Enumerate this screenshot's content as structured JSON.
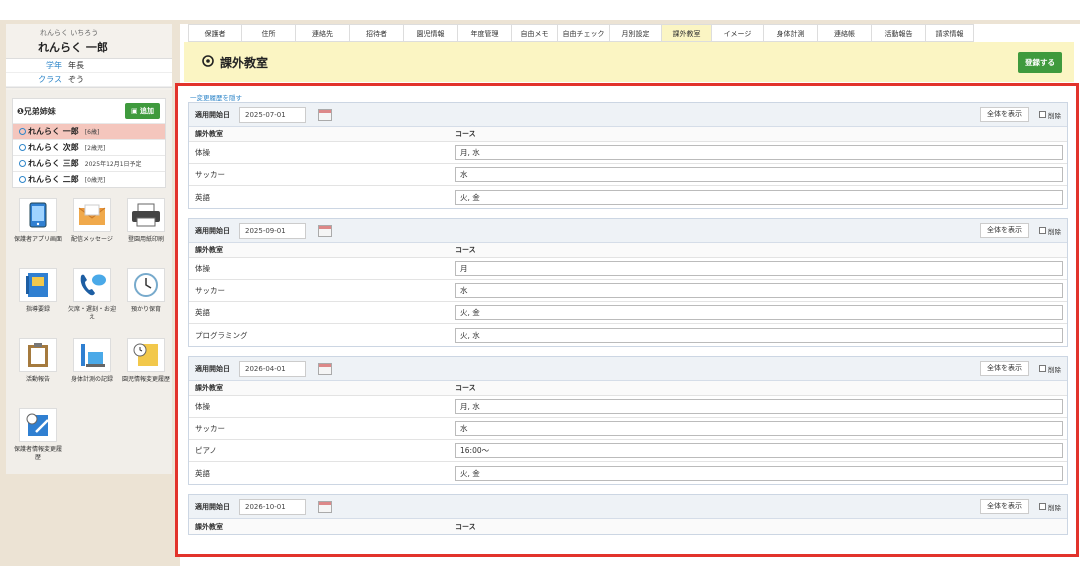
{
  "student": {
    "kana": "れんらく いちろう",
    "name": "れんらく 一郎",
    "grade_label": "学年",
    "grade_value": "年長",
    "class_label": "クラス",
    "class_value": "ぞう"
  },
  "siblings": {
    "title": "兄弟姉妹",
    "add_label": "追加",
    "items": [
      {
        "name": "れんらく 一郎",
        "age": "[6歳]"
      },
      {
        "name": "れんらく 次郎",
        "age": "[2歳児]"
      },
      {
        "name": "れんらく 三郎",
        "age": "2025年12月1日予定"
      },
      {
        "name": "れんらく 二郎",
        "age": "[0歳児]"
      }
    ]
  },
  "menu": [
    {
      "label": "保護者アプリ画面",
      "icon": "smartphone-icon"
    },
    {
      "label": "配信メッセージ",
      "icon": "envelope-icon"
    },
    {
      "label": "登園用紙印刷",
      "icon": "printer-icon"
    },
    {
      "label": "指導要録",
      "icon": "notebook-icon"
    },
    {
      "label": "欠席・遅刻・お迎え",
      "icon": "phone-chat-icon"
    },
    {
      "label": "預かり保育",
      "icon": "clock-icon"
    },
    {
      "label": "活動報告",
      "icon": "clipboard-icon"
    },
    {
      "label": "身体計測の記録",
      "icon": "scale-icon"
    },
    {
      "label": "園児情報変更履歴",
      "icon": "note-clock-icon"
    },
    {
      "label": "保護者情報変更履歴",
      "icon": "edit-note-icon"
    }
  ],
  "tabs": [
    {
      "label": "保護者",
      "active": false
    },
    {
      "label": "住所",
      "active": false
    },
    {
      "label": "連絡先",
      "active": false
    },
    {
      "label": "招待者",
      "active": false
    },
    {
      "label": "園児情報",
      "active": false
    },
    {
      "label": "年度管理",
      "active": false
    },
    {
      "label": "自由メモ",
      "active": false
    },
    {
      "label": "自由チェック",
      "active": false
    },
    {
      "label": "月別設定",
      "active": false
    },
    {
      "label": "課外教室",
      "active": true
    },
    {
      "label": "イメージ",
      "active": false
    },
    {
      "label": "身体計測",
      "active": false
    },
    {
      "label": "連絡帳",
      "active": false
    },
    {
      "label": "活動報告",
      "active": false
    },
    {
      "label": "請求情報",
      "active": false
    }
  ],
  "page": {
    "title": "課外教室",
    "register_label": "登録する",
    "history_link": "一変更履歴を隠す",
    "start_label": "適用開始日",
    "show_all_label": "全体を表示",
    "delete_label": "削除",
    "col_class": "課外教室",
    "col_course": "コース"
  },
  "panels": [
    {
      "date": "2025-07-01",
      "rows": [
        {
          "name": "体操",
          "course": "月, 水"
        },
        {
          "name": "サッカー",
          "course": "水"
        },
        {
          "name": "英語",
          "course": "火, 金"
        }
      ]
    },
    {
      "date": "2025-09-01",
      "rows": [
        {
          "name": "体操",
          "course": "月"
        },
        {
          "name": "サッカー",
          "course": "水"
        },
        {
          "name": "英語",
          "course": "火, 金"
        },
        {
          "name": "プログラミング",
          "course": "火, 水"
        }
      ]
    },
    {
      "date": "2026-04-01",
      "rows": [
        {
          "name": "体操",
          "course": "月, 水"
        },
        {
          "name": "サッカー",
          "course": "水"
        },
        {
          "name": "ピアノ",
          "course": "16:00〜"
        },
        {
          "name": "英語",
          "course": "火, 金"
        }
      ]
    },
    {
      "date": "2026-10-01",
      "rows": []
    }
  ]
}
